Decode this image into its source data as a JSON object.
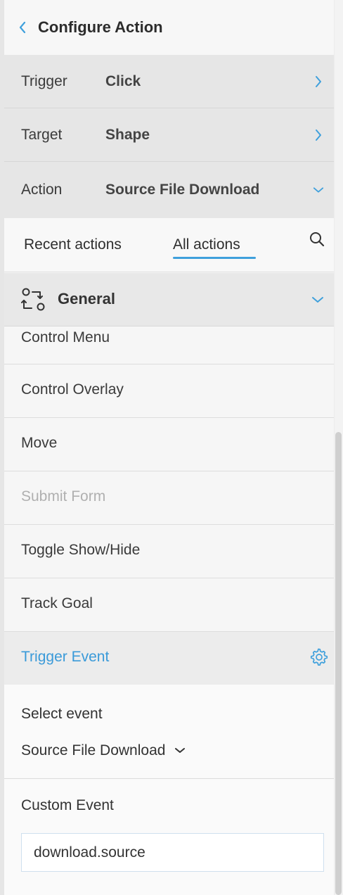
{
  "header": {
    "title": "Configure Action"
  },
  "settings": [
    {
      "key": "Trigger",
      "value": "Click"
    },
    {
      "key": "Target",
      "value": "Shape"
    },
    {
      "key": "Action",
      "value": "Source File Download"
    }
  ],
  "tabs": {
    "recent": "Recent actions",
    "all": "All actions",
    "active": "All actions"
  },
  "group": {
    "label": "General"
  },
  "actions": [
    {
      "label": "Control Menu",
      "state": "normal"
    },
    {
      "label": "Control Overlay",
      "state": "normal"
    },
    {
      "label": "Move",
      "state": "normal"
    },
    {
      "label": "Submit Form",
      "state": "disabled"
    },
    {
      "label": "Toggle Show/Hide",
      "state": "normal"
    },
    {
      "label": "Track Goal",
      "state": "normal"
    },
    {
      "label": "Trigger Event",
      "state": "selected"
    }
  ],
  "config": {
    "select_event_label": "Select event",
    "select_event_value": "Source File Download",
    "custom_event_label": "Custom Event",
    "custom_event_value": "download.source"
  },
  "colors": {
    "accent": "#3fa0dc",
    "selected_text": "#3a9ad9",
    "disabled_text": "#b0b0b0"
  },
  "icons": {
    "back": "chevron-left-icon",
    "trigger": "chevron-right-icon",
    "target": "chevron-right-icon",
    "action": "chevron-down-icon",
    "search": "search-icon",
    "group": "workflow-icon",
    "group_toggle": "chevron-down-icon",
    "settings": "gear-icon",
    "dropdown": "chevron-down-icon"
  }
}
